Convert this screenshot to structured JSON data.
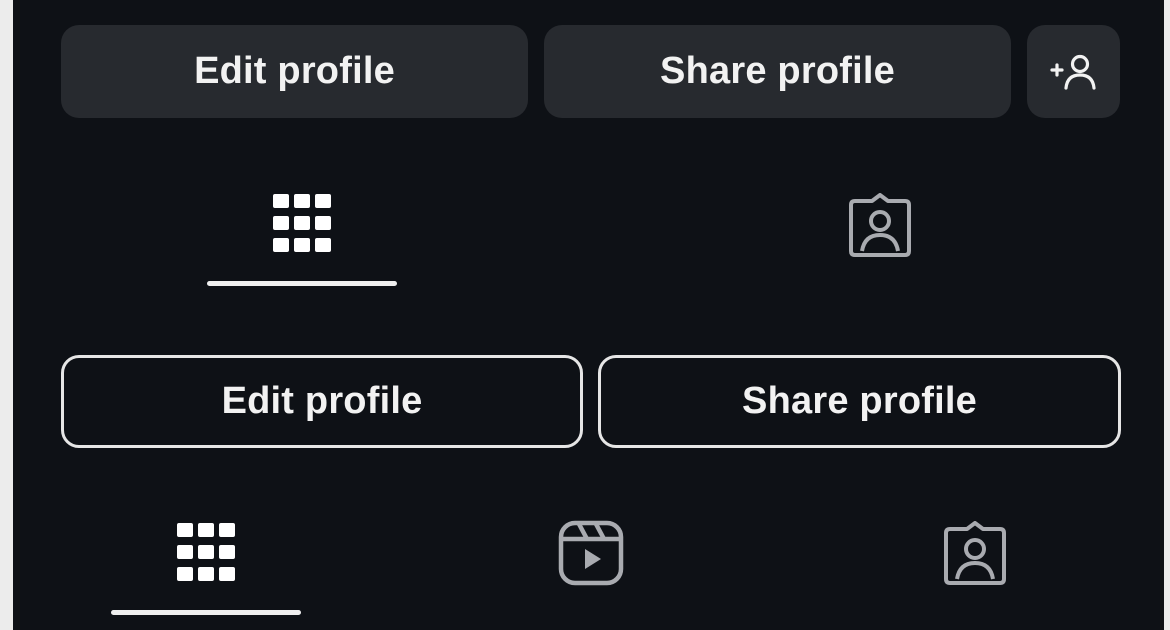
{
  "top_section": {
    "edit_label": "Edit profile",
    "share_label": "Share profile",
    "add_person_icon": "person-add-icon",
    "tabs": [
      {
        "icon": "grid-icon",
        "selected": true
      },
      {
        "icon": "tagged-icon",
        "selected": false
      }
    ]
  },
  "bottom_section": {
    "edit_label": "Edit profile",
    "share_label": "Share profile",
    "tabs": [
      {
        "icon": "grid-icon",
        "selected": true
      },
      {
        "icon": "reels-icon",
        "selected": false
      },
      {
        "icon": "tagged-icon",
        "selected": false
      }
    ]
  },
  "colors": {
    "background": "#0e1116",
    "button_fill": "#272a2f",
    "text": "#f2f2f2",
    "icon_inactive": "#a9abb0",
    "icon_active": "#ffffff"
  }
}
